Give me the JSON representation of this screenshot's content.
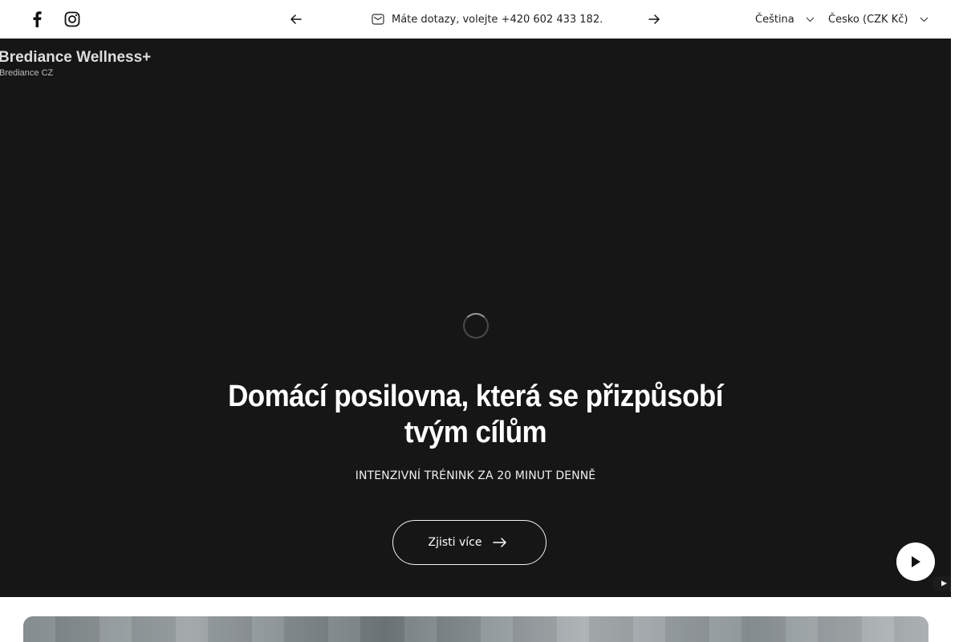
{
  "topbar": {
    "social": [
      {
        "name": "facebook-icon"
      },
      {
        "name": "instagram-icon"
      }
    ],
    "announcement": "Máte dotazy, volejte +420 602 433 182.",
    "language": "Čeština",
    "country": "Česko (CZK Kč)"
  },
  "hero": {
    "video_title": "Brediance Wellness+",
    "video_channel": "Brediance CZ",
    "heading": "Domácí posilovna, která se přizpůsobí tvým cílům",
    "subheading": "INTENZIVNÍ TRÉNINK ZA 20 MINUT DENNĚ",
    "cta_label": "Zjisti více"
  },
  "colors": {
    "hero_background": "#161616",
    "text_light": "#ffffff",
    "topbar_background": "#ffffff"
  }
}
